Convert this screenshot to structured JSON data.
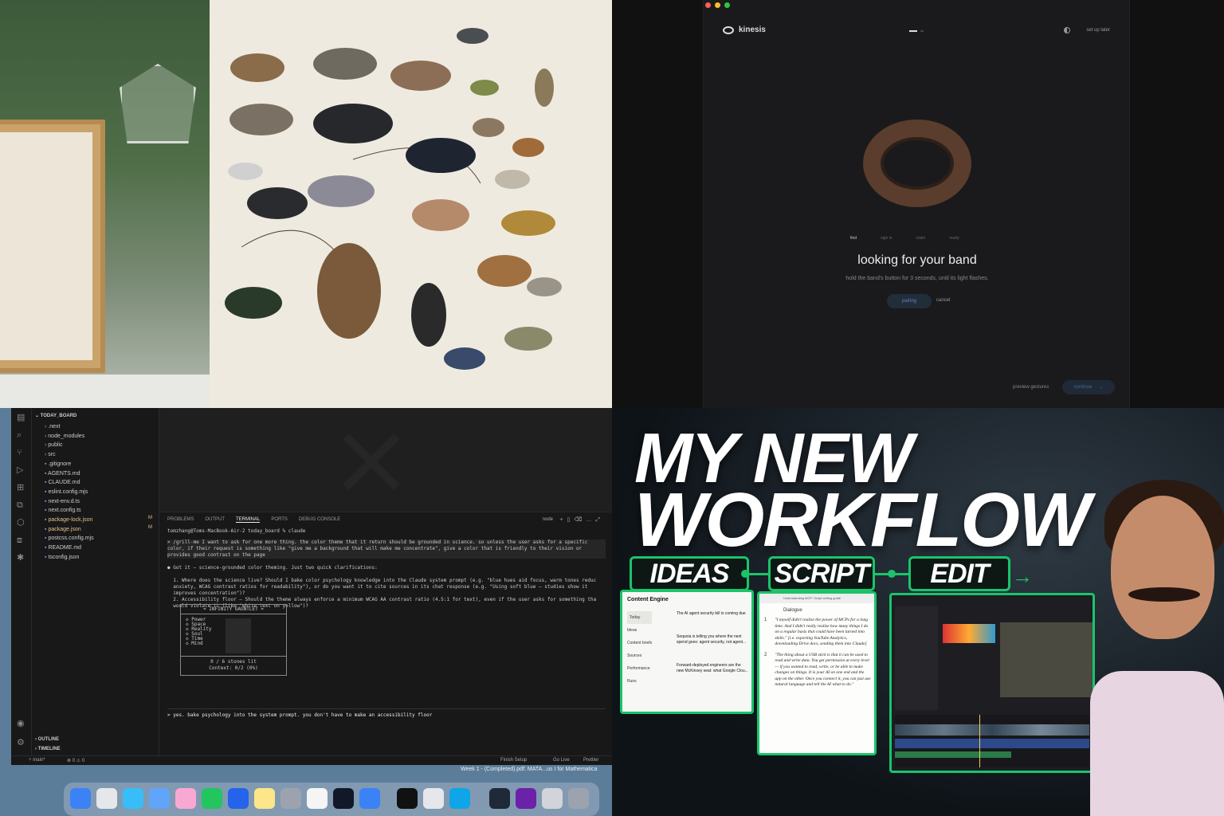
{
  "kinesis": {
    "brand": "kinesis",
    "setup_later": "set up later",
    "steps": [
      "find",
      "sign in",
      "claim",
      "ready"
    ],
    "title": "looking for your band",
    "subtitle": "hold the band's button for 3 seconds, until its light flashes.",
    "pairing": "pairing",
    "cancel": "cancel",
    "preview": "preview gestures",
    "continue": "continue"
  },
  "vscode": {
    "explorer_root": "TODAY_BOARD",
    "files": [
      {
        "name": ".next",
        "folder": true,
        "mod": false
      },
      {
        "name": "node_modules",
        "folder": true,
        "mod": false
      },
      {
        "name": "public",
        "folder": true,
        "mod": false
      },
      {
        "name": "src",
        "folder": true,
        "mod": false
      },
      {
        "name": ".gitignore",
        "folder": false,
        "mod": false
      },
      {
        "name": "AGENTS.md",
        "folder": false,
        "mod": false
      },
      {
        "name": "CLAUDE.md",
        "folder": false,
        "mod": false
      },
      {
        "name": "eslint.config.mjs",
        "folder": false,
        "mod": false
      },
      {
        "name": "next-env.d.ts",
        "folder": false,
        "mod": false
      },
      {
        "name": "next.config.ts",
        "folder": false,
        "mod": false
      },
      {
        "name": "package-lock.json",
        "folder": false,
        "mod": true
      },
      {
        "name": "package.json",
        "folder": false,
        "mod": true
      },
      {
        "name": "postcss.config.mjs",
        "folder": false,
        "mod": false
      },
      {
        "name": "README.md",
        "folder": false,
        "mod": false
      },
      {
        "name": "tsconfig.json",
        "folder": false,
        "mod": false
      }
    ],
    "mod_badge": "M",
    "outline": "OUTLINE",
    "timeline": "TIMELINE",
    "panel_tabs": [
      "PROBLEMS",
      "OUTPUT",
      "TERMINAL",
      "PORTS",
      "DEBUG CONSOLE"
    ],
    "panel_shell": "node",
    "prompt": "tomzhang@Toms-MacBook-Air-2 today_board % claude",
    "terminal_lines": [
      "> /grill-me I want to ask for one more thing. the color theme that it return should be grounded in science. so unless the user asks for a specific",
      "color, if their request is something like \"give me a background that will make me concentrate\", give a color that is friendly to their vision or",
      "provides good contrast on the page",
      "",
      "● Got it — science-grounded color theming. Just two quick clarifications:",
      "",
      "  1. Where does the science live? Should I bake color psychology knowledge into the Claude system prompt (e.g. \"blue hues aid focus, warm tones reduc",
      "  anxiety, WCAG contrast ratios for readability\"), or do you want it to cite sources in its chat response (e.g. \"Using soft blue — studies show it",
      "  improves concentration\")?",
      "  2. Accessibility floor — Should the theme always enforce a minimum WCAG AA contrast ratio (4.5:1 for text), even if the user asks for something tha",
      "  would violate it (like \"white text on yellow\")?"
    ],
    "gauntlet_title": "= INFINITY GAUNTLET =",
    "stones": [
      "◇ Power",
      "◇ Space",
      "◇ Reality",
      "◇ Soul",
      "◇ Time",
      "◇ Mind"
    ],
    "stones_lit": "0 / 6 stones lit",
    "context": "Context: 0/2 (0%)",
    "input": "> yes. bake psychology into the system prompt. you don't have to make an accessibility floor",
    "status_branch": "main*",
    "status_errors": "⊗ 0 ⚠ 0",
    "status_finish": "Finish Setup",
    "status_golive": "Go Live",
    "status_prettier": "Prettier",
    "notification": "Week 1 - (Completed).pdf: MATA...us I for Mathematica"
  },
  "thumbnail": {
    "line1": "MY NEW",
    "line2": "WORKFLOW",
    "tags": [
      "IDEAS",
      "SCRIPT",
      "EDIT"
    ],
    "card1_title": "Content Engine",
    "card1_nav": [
      "Today",
      "Ideas",
      "Content briefs",
      "Sources",
      "Performance",
      "Runs"
    ],
    "card1_items": [
      "The AI agent security bill is coming due",
      "Sequoia is telling you where the next spend goes: agent security, not agent...",
      "Forward-deployed engineers are the new McKinsey seat: what Google Clou..."
    ],
    "card2_tab": "Understanding MCP: Script writing guide",
    "card2_header": "Dialogue",
    "card2_rows": [
      {
        "num": "1",
        "text": "\"I myself didn't realize the power of MCPs for a long time. And I didn't really realize how many things I do on a regular basis that could have been turned into skills.\" [i.e. exporting YouTube Analytics, downloading Drive docs, sending them into Claude]"
      },
      {
        "num": "2",
        "text": "\"The thing about a USB stick is that it can be used to read and write data. You get permission at every level — if you wanted to read, write, or be able to make changes on things. It is your AI on one end and the app on the other. Once you connect it, you can just use natural language and tell the AI what to do.\""
      }
    ]
  },
  "colors": {
    "accent_green": "#1ac46b",
    "kinesis_bg": "#1a1a1c",
    "vscode_bg": "#181818"
  }
}
